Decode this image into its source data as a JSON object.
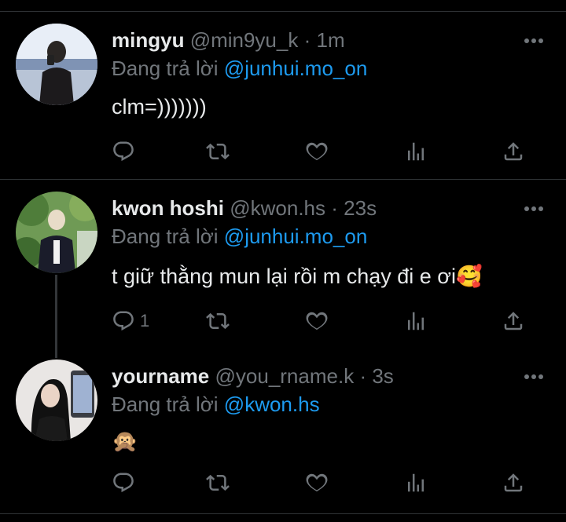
{
  "tweets": [
    {
      "name": "mingyu",
      "handle": "@min9yu_k",
      "time": "1m",
      "reply_prefix": "Đang trả lời",
      "reply_to": "@junhui.mo_on",
      "text": "clm=)))))))",
      "reply_count": "",
      "avatar": "mirror-selfie-photo"
    },
    {
      "name": "kwon hoshi",
      "handle": "@kwon.hs",
      "time": "23s",
      "reply_prefix": "Đang trả lời",
      "reply_to": "@junhui.mo_on",
      "text": "t giữ thằng mun lại rồi m chạy đi e ơi",
      "emoji": "🥰",
      "reply_count": "1",
      "avatar": "outdoor-photo"
    },
    {
      "name": "yourname",
      "handle": "@you_rname.k",
      "time": "3s",
      "reply_prefix": "Đang trả lời",
      "reply_to": "@kwon.hs",
      "text": "",
      "emoji": "🙊",
      "reply_count": "",
      "avatar": "phone-selfie-photo"
    }
  ],
  "separator": "·",
  "icons": {
    "reply": "reply-icon",
    "retweet": "retweet-icon",
    "like": "heart-icon",
    "views": "views-icon",
    "share": "share-icon",
    "more": "more-icon"
  },
  "colors": {
    "background": "#000000",
    "text": "#e7e9ea",
    "muted": "#71767b",
    "accent": "#1d9bf0",
    "divider": "#2f3336"
  }
}
